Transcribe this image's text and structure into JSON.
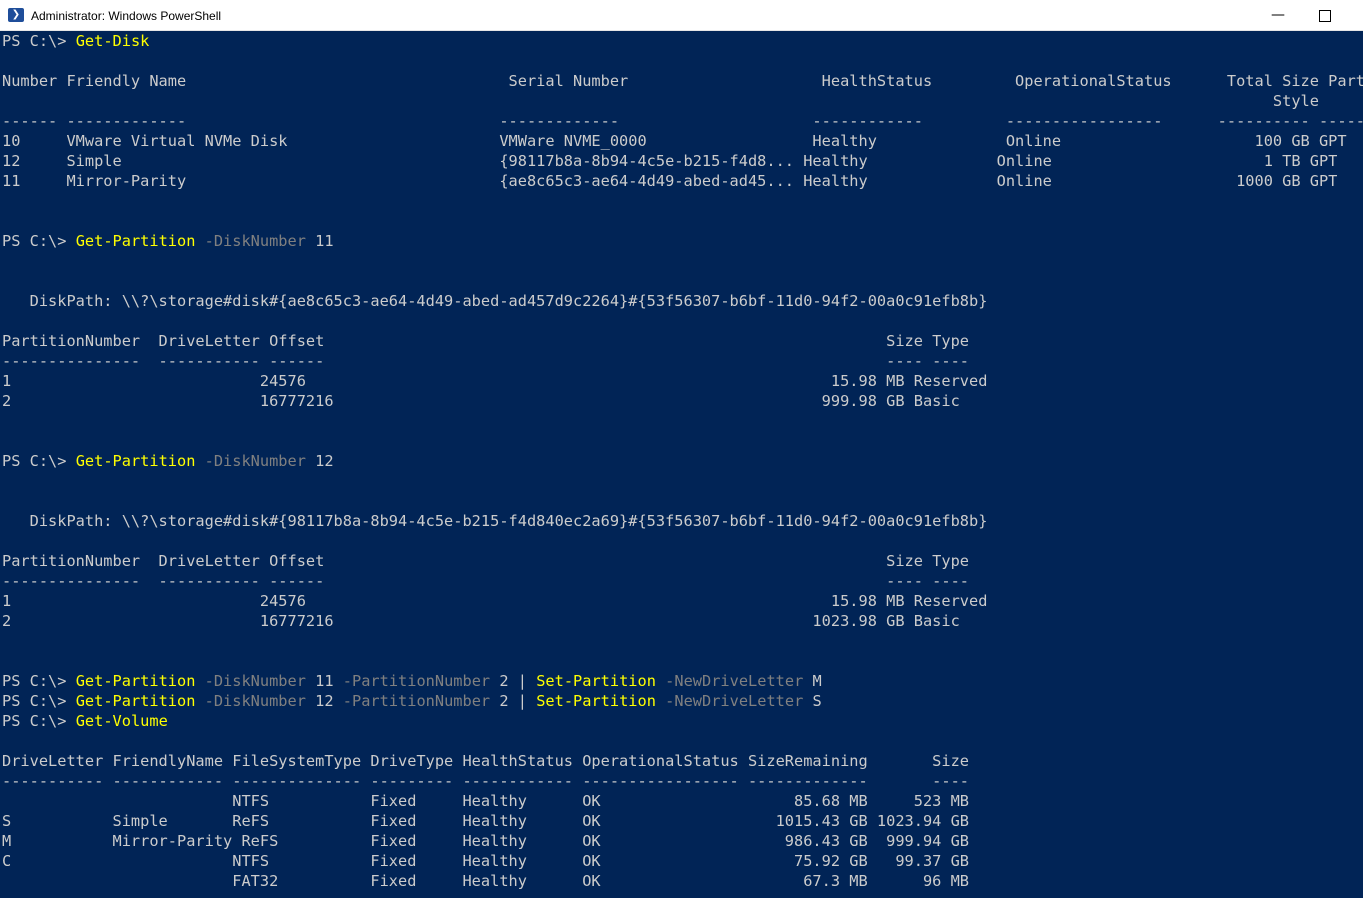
{
  "window": {
    "title": "Administrator: Windows PowerShell",
    "min_glyph": "—",
    "close_glyph": "✕"
  },
  "colors": {
    "background": "#012456",
    "output_text": "#cccccc",
    "command": "#ffff00",
    "parameter": "#808080"
  },
  "console": {
    "lines": [
      [
        {
          "t": "PS C:\\> "
        },
        {
          "t": "Get-Disk",
          "c": "y"
        }
      ],
      [],
      [
        {
          "t": "Number Friendly Name                                   Serial Number                     HealthStatus         OperationalStatus      Total Size Partition"
        }
      ],
      [
        {
          "t": "                                                                                                                                          Style"
        }
      ],
      [
        {
          "t": "------ -------------                                  -------------                     ------------         -----------------      ---------- ---------"
        }
      ],
      [
        {
          "t": "10     VMware Virtual NVMe Disk                       VMWare NVME_0000                  Healthy              Online                     100 GB GPT"
        }
      ],
      [
        {
          "t": "12     Simple                                         {98117b8a-8b94-4c5e-b215-f4d8... Healthy              Online                       1 TB GPT"
        }
      ],
      [
        {
          "t": "11     Mirror-Parity                                  {ae8c65c3-ae64-4d49-abed-ad45... Healthy              Online                    1000 GB GPT"
        }
      ],
      [],
      [],
      [
        {
          "t": "PS C:\\> "
        },
        {
          "t": "Get-Partition",
          "c": "y"
        },
        {
          "t": " -DiskNumber",
          "c": "g"
        },
        {
          "t": " 11"
        }
      ],
      [],
      [],
      [
        {
          "t": "   DiskPath: \\\\?\\storage#disk#{ae8c65c3-ae64-4d49-abed-ad457d9c2264}#{53f56307-b6bf-11d0-94f2-00a0c91efb8b}"
        }
      ],
      [],
      [
        {
          "t": "PartitionNumber  DriveLetter Offset                                                             Size Type"
        }
      ],
      [
        {
          "t": "---------------  ----------- ------                                                             ---- ----"
        }
      ],
      [
        {
          "t": "1                           24576                                                         15.98 MB Reserved"
        }
      ],
      [
        {
          "t": "2                           16777216                                                     999.98 GB Basic"
        }
      ],
      [],
      [],
      [
        {
          "t": "PS C:\\> "
        },
        {
          "t": "Get-Partition",
          "c": "y"
        },
        {
          "t": " -DiskNumber",
          "c": "g"
        },
        {
          "t": " 12"
        }
      ],
      [],
      [],
      [
        {
          "t": "   DiskPath: \\\\?\\storage#disk#{98117b8a-8b94-4c5e-b215-f4d840ec2a69}#{53f56307-b6bf-11d0-94f2-00a0c91efb8b}"
        }
      ],
      [],
      [
        {
          "t": "PartitionNumber  DriveLetter Offset                                                             Size Type"
        }
      ],
      [
        {
          "t": "---------------  ----------- ------                                                             ---- ----"
        }
      ],
      [
        {
          "t": "1                           24576                                                         15.98 MB Reserved"
        }
      ],
      [
        {
          "t": "2                           16777216                                                    1023.98 GB Basic"
        }
      ],
      [],
      [],
      [
        {
          "t": "PS C:\\> "
        },
        {
          "t": "Get-Partition",
          "c": "y"
        },
        {
          "t": " -DiskNumber",
          "c": "g"
        },
        {
          "t": " 11"
        },
        {
          "t": " -PartitionNumber",
          "c": "g"
        },
        {
          "t": " 2 | "
        },
        {
          "t": "Set-Partition",
          "c": "y"
        },
        {
          "t": " -NewDriveLetter",
          "c": "g"
        },
        {
          "t": " M"
        }
      ],
      [
        {
          "t": "PS C:\\> "
        },
        {
          "t": "Get-Partition",
          "c": "y"
        },
        {
          "t": " -DiskNumber",
          "c": "g"
        },
        {
          "t": " 12"
        },
        {
          "t": " -PartitionNumber",
          "c": "g"
        },
        {
          "t": " 2 | "
        },
        {
          "t": "Set-Partition",
          "c": "y"
        },
        {
          "t": " -NewDriveLetter",
          "c": "g"
        },
        {
          "t": " S"
        }
      ],
      [
        {
          "t": "PS C:\\> "
        },
        {
          "t": "Get-Volume",
          "c": "y"
        }
      ],
      [],
      [
        {
          "t": "DriveLetter FriendlyName FileSystemType DriveType HealthStatus OperationalStatus SizeRemaining       Size"
        }
      ],
      [
        {
          "t": "----------- ------------ -------------- --------- ------------ ----------------- -------------       ----"
        }
      ],
      [
        {
          "t": "                         NTFS           Fixed     Healthy      OK                     85.68 MB     523 MB"
        }
      ],
      [
        {
          "t": "S           Simple       ReFS           Fixed     Healthy      OK                   1015.43 GB 1023.94 GB"
        }
      ],
      [
        {
          "t": "M           Mirror-Parity ReFS          Fixed     Healthy      OK                    986.43 GB  999.94 GB"
        }
      ],
      [
        {
          "t": "C                        NTFS           Fixed     Healthy      OK                     75.92 GB   99.37 GB"
        }
      ],
      [
        {
          "t": "                         FAT32          Fixed     Healthy      OK                      67.3 MB      96 MB"
        }
      ]
    ]
  }
}
